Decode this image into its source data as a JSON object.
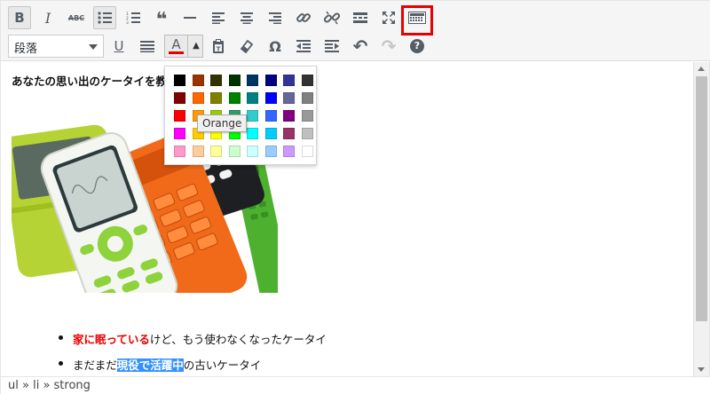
{
  "toolbar": {
    "row1": [
      {
        "name": "bold-button",
        "icon": "bold-icon",
        "glyph": "B",
        "active": true
      },
      {
        "name": "italic-button",
        "icon": "italic-icon",
        "glyph": "I"
      },
      {
        "name": "strikethrough-button",
        "icon": "strikethrough-icon",
        "glyph": "ABC"
      },
      {
        "name": "bullet-list-button",
        "icon": "bullet-list-icon",
        "active": true
      },
      {
        "name": "numbered-list-button",
        "icon": "numbered-list-icon"
      },
      {
        "name": "blockquote-button",
        "icon": "blockquote-icon",
        "glyph": "❝"
      },
      {
        "name": "horizontal-line-button",
        "icon": "horizontal-line-icon"
      },
      {
        "name": "align-left-button",
        "icon": "align-left-icon"
      },
      {
        "name": "align-center-button",
        "icon": "align-center-icon"
      },
      {
        "name": "align-right-button",
        "icon": "align-right-icon"
      },
      {
        "name": "insert-link-button",
        "icon": "link-icon"
      },
      {
        "name": "remove-link-button",
        "icon": "unlink-icon"
      },
      {
        "name": "read-more-button",
        "icon": "read-more-icon"
      },
      {
        "name": "fullscreen-button",
        "icon": "fullscreen-icon"
      },
      {
        "name": "toolbar-toggle-button",
        "icon": "keyboard-icon",
        "highlighted": true
      }
    ],
    "format_select": {
      "value": "段落"
    },
    "row2": [
      {
        "name": "underline-button",
        "icon": "underline-icon",
        "glyph": "U"
      },
      {
        "name": "justify-button",
        "icon": "justify-icon"
      },
      {
        "name": "paste-as-text-button",
        "icon": "clipboard-icon"
      },
      {
        "name": "clear-formatting-button",
        "icon": "eraser-icon"
      },
      {
        "name": "special-character-button",
        "icon": "omega-icon",
        "glyph": "Ω"
      },
      {
        "name": "outdent-button",
        "icon": "outdent-icon"
      },
      {
        "name": "indent-button",
        "icon": "indent-icon"
      },
      {
        "name": "undo-button",
        "icon": "undo-icon",
        "glyph": "↶"
      },
      {
        "name": "redo-button",
        "icon": "redo-icon",
        "glyph": "↷",
        "disabled": true
      },
      {
        "name": "help-button",
        "icon": "help-icon",
        "glyph": "?"
      }
    ],
    "text_color": {
      "glyph": "A",
      "arrow": "▲",
      "bar_color": "#e60000"
    }
  },
  "content": {
    "title": "あなたの思い出のケータイを教",
    "bullets": [
      {
        "strong": "家に眠っている",
        "rest": "けど、もう使わなくなったケータイ"
      },
      {
        "pre": "まだまだ",
        "strong": "現役で活躍中",
        "rest": "の古いケータイ"
      }
    ]
  },
  "palette": {
    "colors": [
      [
        "#000000",
        "#993300",
        "#333300",
        "#003300",
        "#003366",
        "#000080",
        "#333399",
        "#333333"
      ],
      [
        "#800000",
        "#ff6600",
        "#808000",
        "#008000",
        "#008080",
        "#0000ff",
        "#666699",
        "#808080"
      ],
      [
        "#ff0000",
        "#ff9900",
        "#99cc00",
        "#339966",
        "#33cccc",
        "#3366ff",
        "#800080",
        "#999999"
      ],
      [
        "#ff00ff",
        "#ffcc00",
        "#ffff00",
        "#00ff00",
        "#00ffff",
        "#00ccff",
        "#993366",
        "#c0c0c0"
      ],
      [
        "#ff99cc",
        "#ffcc99",
        "#ffff99",
        "#ccffcc",
        "#ccffff",
        "#99ccff",
        "#cc99ff",
        "#ffffff"
      ]
    ],
    "tooltip": "Orange"
  },
  "status_path": {
    "items": [
      "ul",
      "li",
      "strong"
    ],
    "separator": " » "
  }
}
